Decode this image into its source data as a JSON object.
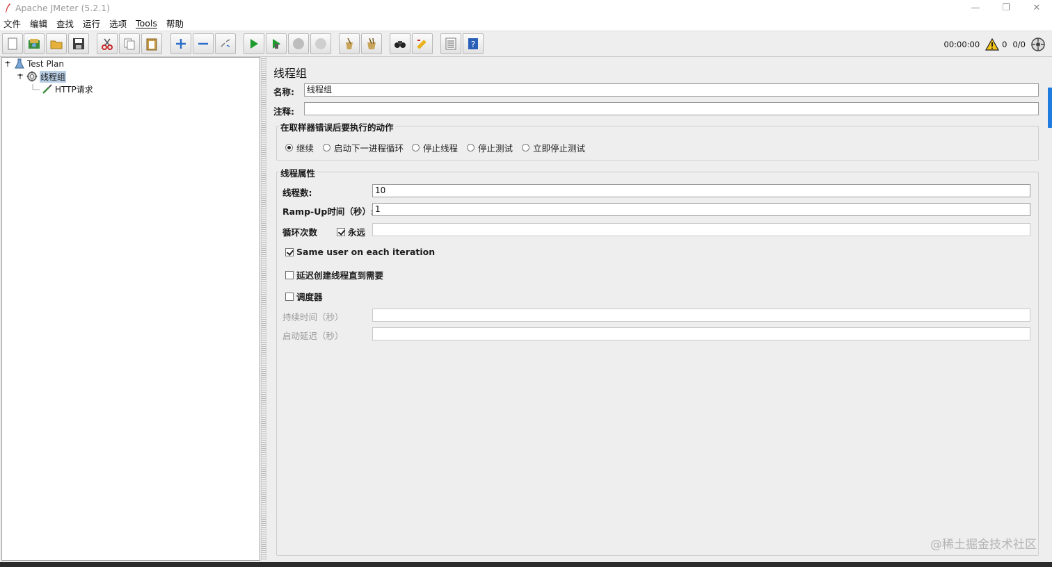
{
  "window": {
    "title": "Apache JMeter (5.2.1)",
    "controls": {
      "minimize": "—",
      "restore": "❐",
      "close": "✕"
    }
  },
  "menubar": [
    "文件",
    "编辑",
    "查找",
    "运行",
    "选项",
    "Tools",
    "帮助"
  ],
  "toolbar": {
    "buttons": [
      {
        "name": "new-icon"
      },
      {
        "name": "templates-icon"
      },
      {
        "name": "open-icon"
      },
      {
        "name": "save-icon"
      },
      {
        "name": "cut-icon"
      },
      {
        "name": "copy-icon"
      },
      {
        "name": "paste-icon"
      },
      {
        "name": "expand-icon"
      },
      {
        "name": "collapse-icon"
      },
      {
        "name": "toggle-icon"
      },
      {
        "name": "start-icon"
      },
      {
        "name": "start-no-pause-icon"
      },
      {
        "name": "stop-icon"
      },
      {
        "name": "shutdown-icon"
      },
      {
        "name": "clear-icon"
      },
      {
        "name": "clear-all-icon"
      },
      {
        "name": "search-icon"
      },
      {
        "name": "reset-search-icon"
      },
      {
        "name": "function-helper-icon"
      },
      {
        "name": "help-icon"
      }
    ],
    "status": {
      "elapsed": "00:00:00",
      "warnings": "0",
      "threads": "0/0"
    }
  },
  "tree": {
    "items": [
      {
        "label": "Test Plan"
      },
      {
        "label": "线程组"
      },
      {
        "label": "HTTP请求"
      }
    ]
  },
  "panel": {
    "title": "线程组",
    "name_label": "名称:",
    "name_value": "线程组",
    "comment_label": "注释:",
    "comment_value": "",
    "error_group": {
      "title": "在取样器错误后要执行的动作",
      "options": [
        {
          "label": "继续",
          "selected": true
        },
        {
          "label": "启动下一进程循环",
          "selected": false
        },
        {
          "label": "停止线程",
          "selected": false
        },
        {
          "label": "停止测试",
          "selected": false
        },
        {
          "label": "立即停止测试",
          "selected": false
        }
      ]
    },
    "thread_group": {
      "title": "线程属性",
      "threads_label": "线程数:",
      "threads_value": "10",
      "rampup_label": "Ramp-Up时间（秒）:",
      "rampup_value": "1",
      "loop_label": "循环次数",
      "forever_label": "永远",
      "forever_checked": true,
      "loop_value": "",
      "same_user_label": "Same user on each iteration",
      "same_user_checked": true,
      "delay_label": "延迟创建线程直到需要",
      "delay_checked": false,
      "scheduler_label": "调度器",
      "scheduler_checked": false,
      "duration_label": "持续时间（秒）",
      "duration_value": "",
      "startup_delay_label": "启动延迟（秒）",
      "startup_delay_value": ""
    }
  },
  "watermark": "@稀土掘金技术社区",
  "accent_color": "#1e7be0"
}
